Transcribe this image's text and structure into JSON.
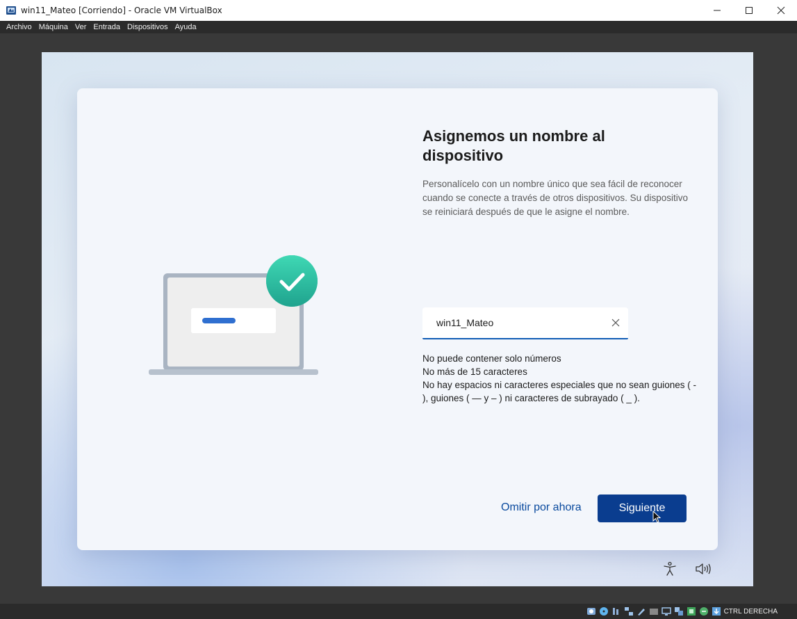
{
  "window": {
    "title": "win11_Mateo [Corriendo] - Oracle VM VirtualBox"
  },
  "menu": [
    "Archivo",
    "Máquina",
    "Ver",
    "Entrada",
    "Dispositivos",
    "Ayuda"
  ],
  "setup": {
    "heading": "Asignemos un nombre al dispositivo",
    "description": "Personalícelo con un nombre único que sea fácil de reconocer cuando se conecte a través de otros dispositivos. Su dispositivo se reiniciará después de que le asigne el nombre.",
    "device_name_value": "win11_Mateo",
    "rules": [
      "No puede contener solo números",
      "No más de 15 caracteres",
      "No hay espacios ni caracteres especiales que no sean guiones ( - ), guiones ( — y – ) ni caracteres de subrayado ( _ )."
    ],
    "skip_label": "Omitir por ahora",
    "next_label": "Siguiente"
  },
  "statusbar": {
    "host_key": "CTRL DERECHA",
    "icons": [
      "hdd-icon",
      "optical-disk-icon",
      "audio-icon",
      "network-icon",
      "usb-icon",
      "shared-folder-icon",
      "display-icon",
      "recording-icon",
      "cpu-icon",
      "mouse-integration-icon",
      "keyboard-icon"
    ]
  },
  "colors": {
    "accent": "#0a3d8f",
    "input_underline": "#0f5bb5",
    "check_teal": "#2ec2a4"
  }
}
